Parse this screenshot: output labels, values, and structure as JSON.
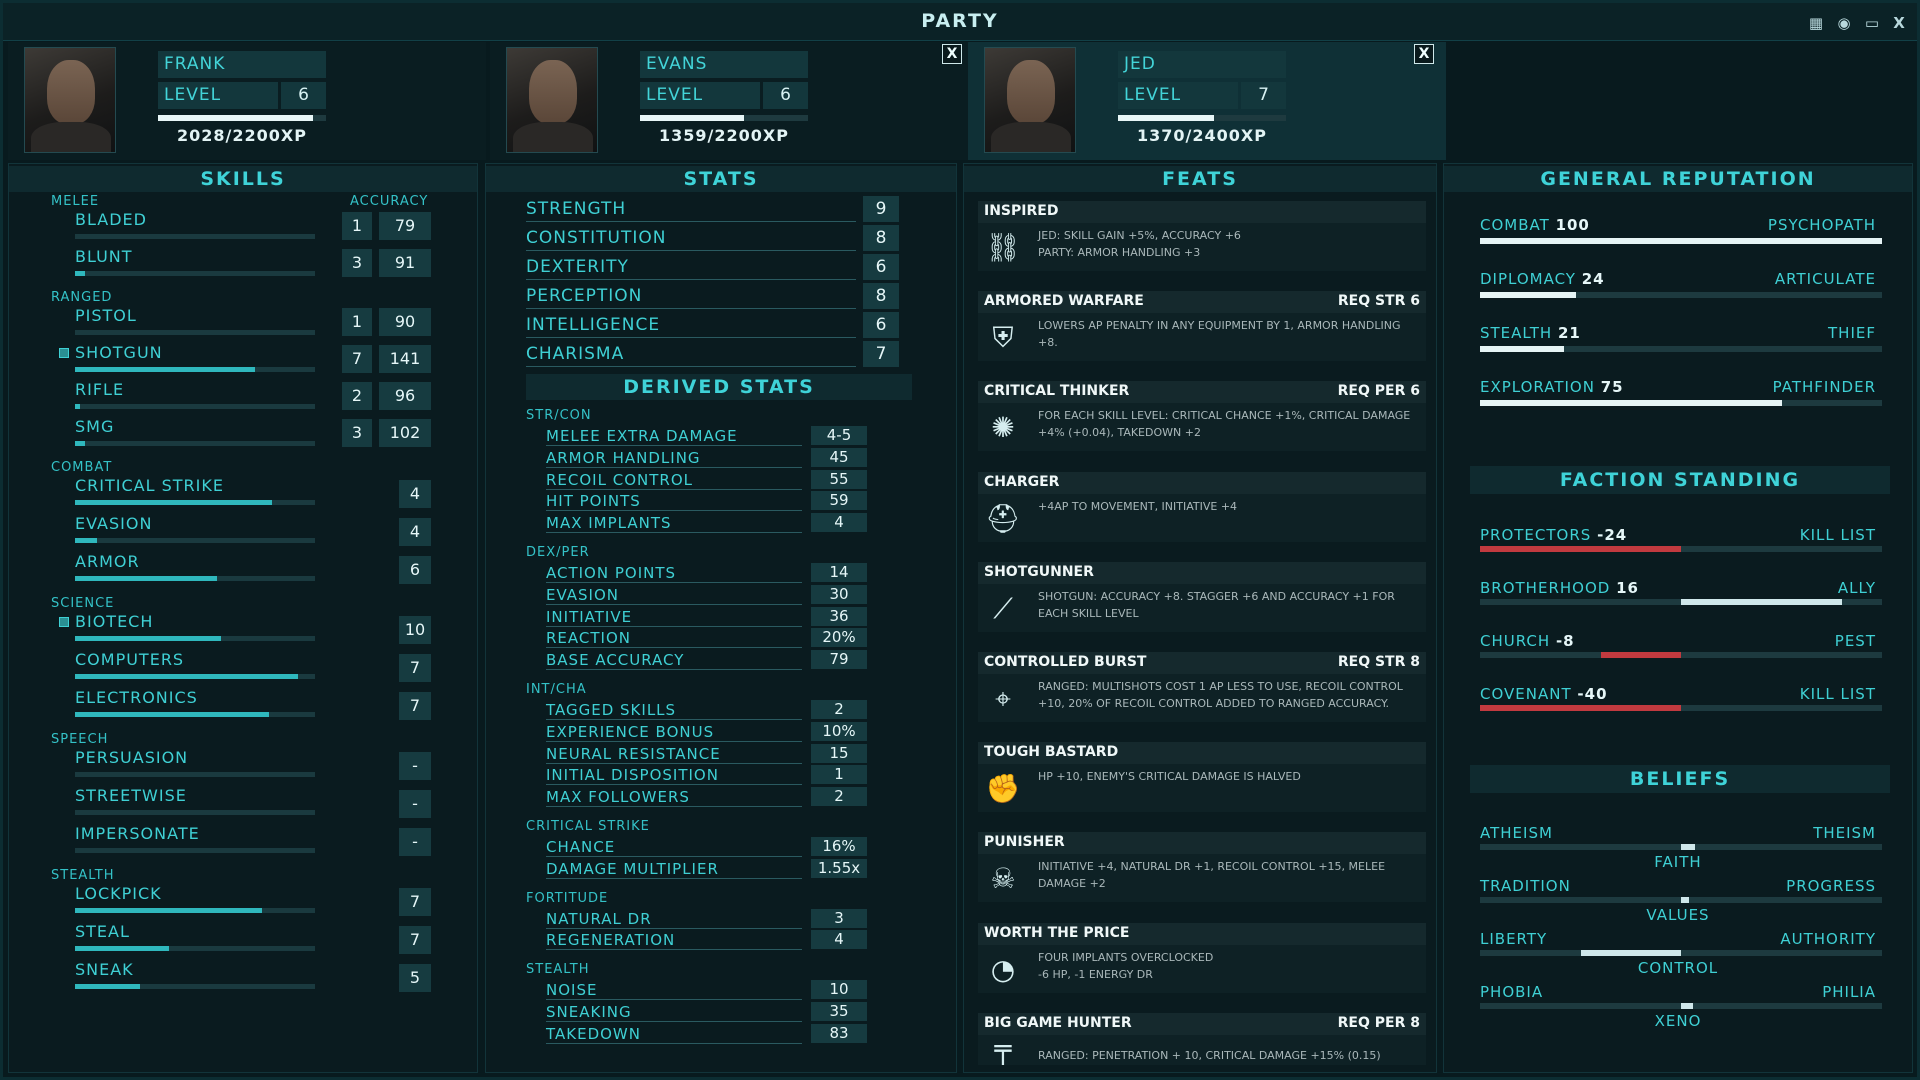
{
  "window": {
    "title": "PARTY",
    "icons": [
      "calendar-icon",
      "brain-icon",
      "chat-icon",
      "close-icon"
    ],
    "close_label": "X"
  },
  "characters": [
    {
      "name": "FRANK",
      "level_label": "LEVEL",
      "level": "6",
      "xp": "2028/2200XP",
      "xp_fraction": 0.92,
      "has_close": false
    },
    {
      "name": "EVANS",
      "level_label": "LEVEL",
      "level": "6",
      "xp": "1359/2200XP",
      "xp_fraction": 0.62,
      "has_close": true,
      "close_label": "X"
    },
    {
      "name": "JED",
      "level_label": "LEVEL",
      "level": "7",
      "xp": "1370/2400XP",
      "xp_fraction": 0.57,
      "has_close": true,
      "close_label": "X"
    }
  ],
  "skills": {
    "title": "SKILLS",
    "accuracy_label": "ACCURACY",
    "groups": [
      {
        "name": "MELEE",
        "items": [
          {
            "name": "BLADED",
            "level": "1",
            "accuracy": "79",
            "progress": 0.0
          },
          {
            "name": "BLUNT",
            "level": "3",
            "accuracy": "91",
            "progress": 0.04
          }
        ]
      },
      {
        "name": "RANGED",
        "items": [
          {
            "name": "PISTOL",
            "level": "1",
            "accuracy": "90",
            "progress": 0.0
          },
          {
            "name": "SHOTGUN",
            "level": "7",
            "accuracy": "141",
            "progress": 0.75,
            "tagged": true
          },
          {
            "name": "RIFLE",
            "level": "2",
            "accuracy": "96",
            "progress": 0.02
          },
          {
            "name": "SMG",
            "level": "3",
            "accuracy": "102",
            "progress": 0.04
          }
        ]
      },
      {
        "name": "COMBAT",
        "items": [
          {
            "name": "CRITICAL STRIKE",
            "level": "4",
            "progress": 0.82
          },
          {
            "name": "EVASION",
            "level": "4",
            "progress": 0.09
          },
          {
            "name": "ARMOR",
            "level": "6",
            "progress": 0.59
          }
        ]
      },
      {
        "name": "SCIENCE",
        "items": [
          {
            "name": "BIOTECH",
            "level": "10",
            "progress": 0.61,
            "tagged": true
          },
          {
            "name": "COMPUTERS",
            "level": "7",
            "progress": 0.93
          },
          {
            "name": "ELECTRONICS",
            "level": "7",
            "progress": 0.81
          }
        ]
      },
      {
        "name": "SPEECH",
        "items": [
          {
            "name": "PERSUASION",
            "level": "-",
            "progress": 0
          },
          {
            "name": "STREETWISE",
            "level": "-",
            "progress": 0
          },
          {
            "name": "IMPERSONATE",
            "level": "-",
            "progress": 0
          }
        ]
      },
      {
        "name": "STEALTH",
        "items": [
          {
            "name": "LOCKPICK",
            "level": "7",
            "progress": 0.78
          },
          {
            "name": "STEAL",
            "level": "7",
            "progress": 0.39
          },
          {
            "name": "SNEAK",
            "level": "5",
            "progress": 0.27
          }
        ]
      }
    ]
  },
  "stats": {
    "title": "STATS",
    "attributes": [
      {
        "name": "STRENGTH",
        "value": "9"
      },
      {
        "name": "CONSTITUTION",
        "value": "8"
      },
      {
        "name": "DEXTERITY",
        "value": "6"
      },
      {
        "name": "PERCEPTION",
        "value": "8"
      },
      {
        "name": "INTELLIGENCE",
        "value": "6"
      },
      {
        "name": "CHARISMA",
        "value": "7"
      }
    ],
    "derived_title": "DERIVED STATS",
    "derived": [
      {
        "name": "STR/CON",
        "items": [
          {
            "name": "MELEE EXTRA DAMAGE",
            "value": "4-5"
          },
          {
            "name": "ARMOR HANDLING",
            "value": "45"
          },
          {
            "name": "RECOIL CONTROL",
            "value": "55"
          },
          {
            "name": "HIT POINTS",
            "value": "59"
          },
          {
            "name": "MAX IMPLANTS",
            "value": "4"
          }
        ]
      },
      {
        "name": "DEX/PER",
        "items": [
          {
            "name": "ACTION POINTS",
            "value": "14"
          },
          {
            "name": "EVASION",
            "value": "30"
          },
          {
            "name": "INITIATIVE",
            "value": "36"
          },
          {
            "name": "REACTION",
            "value": "20%"
          },
          {
            "name": "BASE ACCURACY",
            "value": "79"
          }
        ]
      },
      {
        "name": "INT/CHA",
        "items": [
          {
            "name": "TAGGED SKILLS",
            "value": "2"
          },
          {
            "name": "EXPERIENCE BONUS",
            "value": "10%"
          },
          {
            "name": "NEURAL RESISTANCE",
            "value": "15"
          },
          {
            "name": "INITIAL DISPOSITION",
            "value": "1"
          },
          {
            "name": "MAX FOLLOWERS",
            "value": "2"
          }
        ]
      },
      {
        "name": "CRITICAL STRIKE",
        "items": [
          {
            "name": "CHANCE",
            "value": "16%"
          },
          {
            "name": "DAMAGE MULTIPLIER",
            "value": "1.55x"
          }
        ]
      },
      {
        "name": "FORTITUDE",
        "items": [
          {
            "name": "NATURAL DR",
            "value": "3"
          },
          {
            "name": "REGENERATION",
            "value": "4"
          }
        ]
      },
      {
        "name": "STEALTH",
        "items": [
          {
            "name": "NOISE",
            "value": "10"
          },
          {
            "name": "SNEAKING",
            "value": "35"
          },
          {
            "name": "TAKEDOWN",
            "value": "83"
          }
        ]
      }
    ]
  },
  "feats": {
    "title": "FEATS",
    "items": [
      {
        "name": "INSPIRED",
        "req": "",
        "icon": "chain-link-icon",
        "glyph": "⛓",
        "desc": "JED: SKILL GAIN +5%, ACCURACY +6\nPARTY: ARMOR HANDLING +3"
      },
      {
        "name": "ARMORED WARFARE",
        "req": "REQ STR 6",
        "icon": "armor-icon",
        "glyph": "⛨",
        "desc": "LOWERS AP PENALTY IN ANY EQUIPMENT BY 1, ARMOR HANDLING +8."
      },
      {
        "name": "CRITICAL THINKER",
        "req": "REQ PER 6",
        "icon": "lightbulb-icon",
        "glyph": "✺",
        "desc": "FOR EACH SKILL LEVEL: CRITICAL CHANCE +1%, CRITICAL DAMAGE +4% (+0.04), TAKEDOWN +2"
      },
      {
        "name": "CHARGER",
        "req": "",
        "icon": "helmet-icon",
        "glyph": "⛑",
        "desc": "+4AP TO MOVEMENT, INITIATIVE +4"
      },
      {
        "name": "SHOTGUNNER",
        "req": "",
        "icon": "shotgun-icon",
        "glyph": "⟋",
        "desc": "SHOTGUN: ACCURACY +8. STAGGER +6 AND ACCURACY +1 FOR EACH SKILL LEVEL"
      },
      {
        "name": "CONTROLLED BURST",
        "req": "REQ STR 8",
        "icon": "crosshair-icon",
        "glyph": "⌖",
        "desc": "RANGED: MULTISHOTS COST 1 AP LESS TO USE, RECOIL CONTROL +10, 20% OF RECOIL CONTROL ADDED TO RANGED ACCURACY."
      },
      {
        "name": "TOUGH BASTARD",
        "req": "",
        "icon": "fist-icon",
        "glyph": "✊",
        "desc": "HP +10, ENEMY'S CRITICAL DAMAGE IS HALVED"
      },
      {
        "name": "PUNISHER",
        "req": "",
        "icon": "skull-icon",
        "glyph": "☠",
        "desc": "INITIATIVE +4, NATURAL DR +1, RECOIL CONTROL +15, MELEE DAMAGE +2"
      },
      {
        "name": "WORTH THE PRICE",
        "req": "",
        "icon": "gauge-icon",
        "glyph": "◔",
        "desc": "FOUR IMPLANTS OVERCLOCKED\n-6 HP, -1 ENERGY DR"
      },
      {
        "name": "BIG GAME HUNTER",
        "req": "REQ PER 8",
        "icon": "rifle-icon",
        "glyph": "╤",
        "desc": "RANGED: PENETRATION + 10, CRITICAL DAMAGE +15% (0.15)"
      }
    ]
  },
  "reputation": {
    "title": "GENERAL REPUTATION",
    "items": [
      {
        "name": "COMBAT",
        "value": "100",
        "tier": "PSYCHOPATH",
        "fraction": 1.0
      },
      {
        "name": "DIPLOMACY",
        "value": "24",
        "tier": "ARTICULATE",
        "fraction": 0.24
      },
      {
        "name": "STEALTH",
        "value": "21",
        "tier": "THIEF",
        "fraction": 0.21
      },
      {
        "name": "EXPLORATION",
        "value": "75",
        "tier": "PATHFINDER",
        "fraction": 0.75
      }
    ],
    "faction_title": "FACTION STANDING",
    "factions": [
      {
        "name": "PROTECTORS",
        "value": "-24",
        "tier": "KILL LIST",
        "fraction": -1.0,
        "color": "#c23a3f"
      },
      {
        "name": "BROTHERHOOD",
        "value": "16",
        "tier": "ALLY",
        "fraction": 0.8,
        "color": "#cfe7ea"
      },
      {
        "name": "CHURCH",
        "value": "-8",
        "tier": "PEST",
        "fraction": -0.4,
        "color": "#c23a3f"
      },
      {
        "name": "COVENANT",
        "value": "-40",
        "tier": "KILL LIST",
        "fraction": -1.0,
        "color": "#c23a3f"
      }
    ],
    "beliefs_title": "BELIEFS",
    "beliefs": [
      {
        "left": "ATHEISM",
        "right": "THEISM",
        "label": "FAITH",
        "from": 0.0,
        "to": 0.07
      },
      {
        "left": "TRADITION",
        "right": "PROGRESS",
        "label": "VALUES",
        "from": 0.0,
        "to": 0.02
      },
      {
        "left": "LIBERTY",
        "right": "AUTHORITY",
        "label": "CONTROL",
        "from": -0.5,
        "to": 0.0
      },
      {
        "left": "PHOBIA",
        "right": "PHILIA",
        "label": "XENO",
        "from": 0.0,
        "to": 0.06
      }
    ]
  },
  "colors": {
    "accent": "#3fd0d4",
    "bar": "#2fb8bd",
    "negative": "#c23a3f",
    "positive": "#cfe7ea"
  }
}
